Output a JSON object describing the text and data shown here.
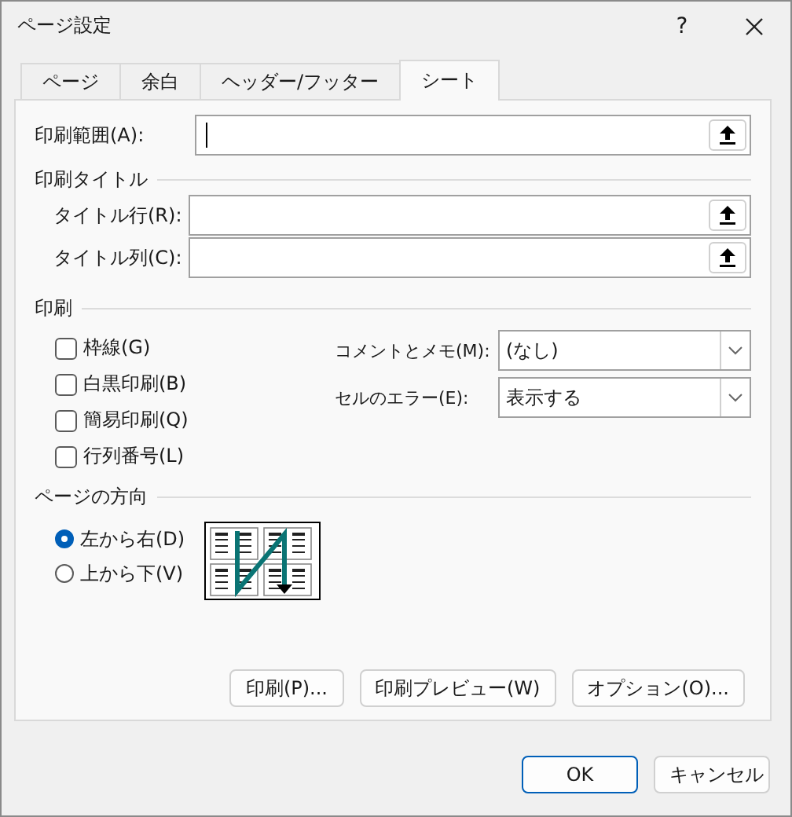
{
  "window": {
    "title": "ページ設定",
    "help": "?"
  },
  "tabs": [
    {
      "label": "ページ",
      "selected": false
    },
    {
      "label": "余白",
      "selected": false
    },
    {
      "label": "ヘッダー/フッター",
      "selected": false
    },
    {
      "label": "シート",
      "selected": true
    }
  ],
  "print_area": {
    "label": "印刷範囲(A):",
    "focused": true
  },
  "print_titles": {
    "heading": "印刷タイトル",
    "fields": [
      {
        "label": "タイトル行(R):"
      },
      {
        "label": "タイトル列(C):"
      }
    ]
  },
  "print": {
    "heading": "印刷",
    "checkboxes": [
      {
        "label": "枠線(G)",
        "checked": false
      },
      {
        "label": "白黒印刷(B)",
        "checked": false
      },
      {
        "label": "簡易印刷(Q)",
        "checked": false
      },
      {
        "label": "行列番号(L)",
        "checked": false
      }
    ],
    "dropdowns": [
      {
        "label": "コメントとメモ(M):",
        "value": "(なし)"
      },
      {
        "label": "セルのエラー(E):",
        "value": "表示する"
      }
    ]
  },
  "page_order": {
    "heading": "ページの方向",
    "options": [
      {
        "label": "左から右(D)",
        "selected": true
      },
      {
        "label": "上から下(V)",
        "selected": false
      }
    ]
  },
  "panel_buttons": [
    {
      "label": "印刷(P)..."
    },
    {
      "label": "印刷プレビュー(W)"
    },
    {
      "label": "オプション(O)..."
    }
  ],
  "dialog_buttons": [
    {
      "label": "OK",
      "default": true
    },
    {
      "label": "キャンセル",
      "default": false
    }
  ]
}
